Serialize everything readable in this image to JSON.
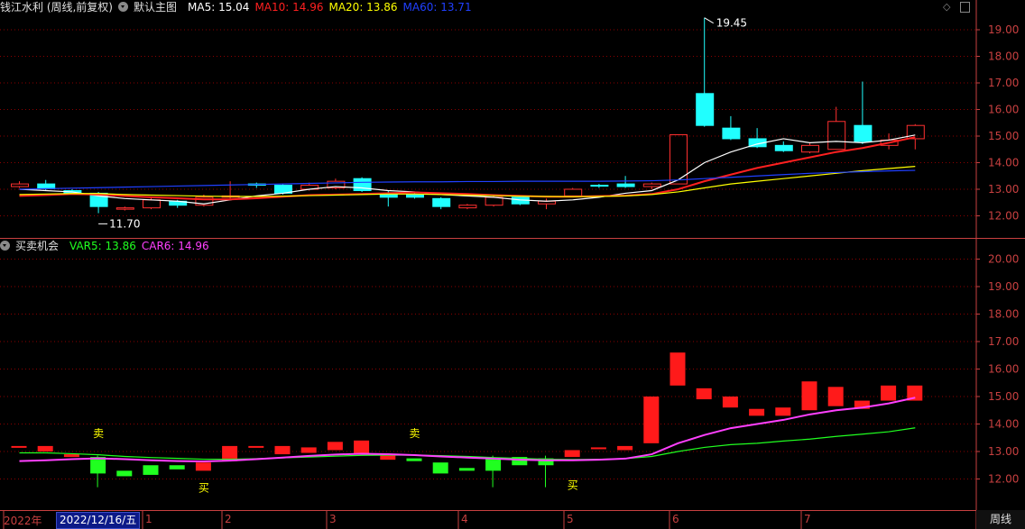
{
  "header": {
    "stock": "钱江水利 (周线,前复权)",
    "main_chart": "默认主图",
    "ma": [
      {
        "label": "MA5: 15.04",
        "color": "#ffffff"
      },
      {
        "label": "MA10: 14.96",
        "color": "#ff2020"
      },
      {
        "label": "MA20: 13.86",
        "color": "#ffff00"
      },
      {
        "label": "MA60: 13.71",
        "color": "#2040ff"
      }
    ],
    "top_right_icons": [
      "diamond-icon",
      "panel-toggle-icon"
    ]
  },
  "sub_header": {
    "indicator": "买卖机会",
    "values": [
      {
        "label": "VAR5: 13.86",
        "color": "#20ff20"
      },
      {
        "label": "CAR6: 14.96",
        "color": "#ff40ff"
      }
    ]
  },
  "colors": {
    "up": "#ff3030",
    "down": "#20ffff",
    "grid": "#8b0000",
    "axis": "#c84040"
  },
  "chart_data": {
    "type": "candlestick",
    "price_axis_main": {
      "ticks": [
        12.0,
        13.0,
        14.0,
        15.0,
        16.0,
        17.0,
        18.0,
        19.0
      ],
      "labels": [
        "12.00",
        "13.00",
        "14.00",
        "15.00",
        "16.00",
        "17.00",
        "18.00",
        "19.00"
      ]
    },
    "price_axis_sub": {
      "ticks": [
        12.0,
        13.0,
        14.0,
        15.0,
        16.0,
        17.0,
        18.0,
        19.0,
        20.0
      ],
      "labels": [
        "12.00",
        "13.00",
        "14.00",
        "15.00",
        "16.00",
        "17.00",
        "18.00",
        "19.00",
        "20.00"
      ]
    },
    "x_labels": [
      "2022年",
      "1",
      "2",
      "3",
      "4",
      "5",
      "6",
      "7"
    ],
    "x_label_candle_index": [
      0,
      5,
      8,
      12,
      17,
      21,
      25,
      30
    ],
    "cursor_date": "2022/12/16/五",
    "period": "周线",
    "annotations": {
      "high": "19.45",
      "low": "11.70"
    },
    "candles": [
      [
        13.1,
        13.2,
        13.05,
        13.3
      ],
      [
        13.2,
        13.02,
        12.95,
        13.35
      ],
      [
        12.95,
        12.85,
        12.8,
        13.0
      ],
      [
        12.85,
        12.35,
        12.1,
        12.9
      ],
      [
        12.25,
        12.3,
        12.2,
        12.35
      ],
      [
        12.3,
        12.6,
        12.25,
        12.7
      ],
      [
        12.55,
        12.4,
        12.3,
        12.6
      ],
      [
        12.4,
        12.7,
        12.35,
        12.8
      ],
      [
        12.7,
        12.75,
        12.6,
        13.3
      ],
      [
        13.2,
        13.15,
        13.05,
        13.25
      ],
      [
        13.15,
        12.85,
        12.8,
        13.2
      ],
      [
        13.0,
        13.15,
        12.95,
        13.25
      ],
      [
        13.05,
        13.3,
        13.0,
        13.4
      ],
      [
        13.4,
        12.95,
        12.9,
        13.45
      ],
      [
        12.8,
        12.7,
        12.35,
        12.95
      ],
      [
        12.8,
        12.7,
        12.65,
        12.85
      ],
      [
        12.65,
        12.35,
        12.25,
        12.7
      ],
      [
        12.3,
        12.4,
        12.25,
        12.45
      ],
      [
        12.4,
        12.7,
        12.35,
        12.75
      ],
      [
        12.7,
        12.45,
        12.4,
        12.75
      ],
      [
        12.45,
        12.55,
        12.25,
        12.65
      ],
      [
        12.75,
        13.0,
        12.7,
        13.05
      ],
      [
        13.15,
        13.12,
        13.05,
        13.2
      ],
      [
        13.2,
        13.1,
        13.05,
        13.5
      ],
      [
        13.1,
        13.2,
        13.0,
        13.25
      ],
      [
        13.2,
        15.05,
        13.2,
        15.05
      ],
      [
        16.6,
        15.4,
        15.35,
        19.45
      ],
      [
        15.3,
        14.9,
        14.85,
        15.75
      ],
      [
        14.9,
        14.6,
        14.55,
        15.3
      ],
      [
        14.65,
        14.45,
        14.4,
        14.8
      ],
      [
        14.4,
        14.65,
        14.35,
        14.75
      ],
      [
        14.5,
        15.55,
        14.5,
        16.1
      ],
      [
        15.4,
        14.8,
        14.7,
        17.05
      ],
      [
        14.65,
        14.85,
        14.5,
        15.1
      ],
      [
        14.9,
        15.4,
        14.5,
        15.45
      ]
    ],
    "series": [
      {
        "name": "MA5",
        "color": "#ffffff",
        "values": [
          13.0,
          12.95,
          12.9,
          12.75,
          12.65,
          12.6,
          12.55,
          12.45,
          12.6,
          12.75,
          12.85,
          13.0,
          13.1,
          13.05,
          12.95,
          12.9,
          12.8,
          12.75,
          12.7,
          12.6,
          12.55,
          12.6,
          12.7,
          12.85,
          12.95,
          13.35,
          14.0,
          14.4,
          14.7,
          14.9,
          14.75,
          14.8,
          14.75,
          14.85,
          15.04
        ]
      },
      {
        "name": "MA10",
        "color": "#ff2020",
        "values": [
          12.75,
          12.78,
          12.82,
          12.8,
          12.75,
          12.7,
          12.66,
          12.62,
          12.62,
          12.66,
          12.72,
          12.78,
          12.8,
          12.82,
          12.85,
          12.88,
          12.85,
          12.82,
          12.78,
          12.75,
          12.72,
          12.72,
          12.74,
          12.76,
          12.82,
          13.0,
          13.3,
          13.55,
          13.8,
          14.0,
          14.2,
          14.4,
          14.55,
          14.75,
          14.96
        ]
      },
      {
        "name": "MA20",
        "color": "#ffff00",
        "values": [
          12.8,
          12.82,
          12.84,
          12.84,
          12.8,
          12.78,
          12.76,
          12.74,
          12.73,
          12.73,
          12.74,
          12.76,
          12.78,
          12.8,
          12.82,
          12.82,
          12.8,
          12.78,
          12.76,
          12.74,
          12.73,
          12.72,
          12.73,
          12.75,
          12.8,
          12.9,
          13.05,
          13.2,
          13.3,
          13.4,
          13.5,
          13.6,
          13.7,
          13.78,
          13.86
        ]
      },
      {
        "name": "MA60",
        "color": "#2040ff",
        "values": [
          13.0,
          13.02,
          13.04,
          13.06,
          13.08,
          13.1,
          13.12,
          13.14,
          13.16,
          13.18,
          13.2,
          13.22,
          13.24,
          13.26,
          13.27,
          13.28,
          13.28,
          13.29,
          13.29,
          13.3,
          13.3,
          13.3,
          13.3,
          13.31,
          13.32,
          13.35,
          13.4,
          13.45,
          13.5,
          13.55,
          13.6,
          13.63,
          13.66,
          13.69,
          13.71
        ]
      }
    ],
    "sub_bars": [
      [
        13.15,
        13.2,
        "up"
      ],
      [
        13.0,
        13.2,
        "up"
      ],
      [
        12.8,
        12.9,
        "up"
      ],
      [
        12.2,
        12.8,
        "down"
      ],
      [
        12.1,
        12.3,
        "down"
      ],
      [
        12.15,
        12.5,
        "down"
      ],
      [
        12.35,
        12.5,
        "down"
      ],
      [
        12.3,
        12.6,
        "up"
      ],
      [
        12.65,
        13.2,
        "up"
      ],
      [
        13.2,
        13.2,
        "up"
      ],
      [
        12.9,
        13.2,
        "up"
      ],
      [
        12.95,
        13.15,
        "up"
      ],
      [
        13.05,
        13.35,
        "up"
      ],
      [
        12.9,
        13.4,
        "up"
      ],
      [
        12.7,
        12.85,
        "up"
      ],
      [
        12.65,
        12.75,
        "down"
      ],
      [
        12.2,
        12.6,
        "down"
      ],
      [
        12.3,
        12.4,
        "down"
      ],
      [
        12.3,
        12.75,
        "down"
      ],
      [
        12.5,
        12.8,
        "down"
      ],
      [
        12.5,
        12.75,
        "down"
      ],
      [
        12.8,
        13.05,
        "up"
      ],
      [
        13.1,
        13.15,
        "up"
      ],
      [
        13.05,
        13.2,
        "up"
      ],
      [
        13.3,
        15.0,
        "up"
      ],
      [
        15.4,
        16.6,
        "up"
      ],
      [
        14.9,
        15.3,
        "up"
      ],
      [
        14.6,
        15.0,
        "up"
      ],
      [
        14.3,
        14.55,
        "up"
      ],
      [
        14.3,
        14.6,
        "up"
      ],
      [
        14.5,
        15.55,
        "up"
      ],
      [
        14.65,
        15.35,
        "up"
      ],
      [
        14.55,
        14.85,
        "up"
      ],
      [
        14.85,
        15.4,
        "up"
      ],
      [
        14.85,
        15.4,
        "up"
      ]
    ],
    "sub_series": [
      {
        "name": "VAR5",
        "color": "#20ff20",
        "values": [
          12.95,
          12.95,
          12.92,
          12.88,
          12.82,
          12.78,
          12.75,
          12.72,
          12.72,
          12.74,
          12.77,
          12.8,
          12.83,
          12.86,
          12.87,
          12.87,
          12.85,
          12.82,
          12.78,
          12.75,
          12.72,
          12.71,
          12.72,
          12.74,
          12.82,
          13.0,
          13.15,
          13.25,
          13.3,
          13.38,
          13.45,
          13.55,
          13.63,
          13.72,
          13.86
        ]
      },
      {
        "name": "CAR6",
        "color": "#ff40ff",
        "values": [
          12.65,
          12.68,
          12.72,
          12.75,
          12.72,
          12.68,
          12.65,
          12.64,
          12.67,
          12.72,
          12.78,
          12.84,
          12.89,
          12.92,
          12.9,
          12.87,
          12.82,
          12.78,
          12.74,
          12.7,
          12.68,
          12.68,
          12.7,
          12.74,
          12.9,
          13.3,
          13.6,
          13.85,
          14.0,
          14.15,
          14.35,
          14.5,
          14.6,
          14.75,
          14.96
        ]
      }
    ],
    "signals": [
      {
        "label": "卖",
        "index": 3,
        "pos": "above",
        "value": 13.2,
        "color": "#ffff00"
      },
      {
        "label": "买",
        "index": 7,
        "pos": "below",
        "value": 12.0,
        "color": "#ffff00"
      },
      {
        "label": "卖",
        "index": 15,
        "pos": "above",
        "value": 13.2,
        "color": "#ffff00"
      },
      {
        "label": "买",
        "index": 21,
        "pos": "below",
        "value": 12.1,
        "color": "#ffff00"
      }
    ]
  }
}
